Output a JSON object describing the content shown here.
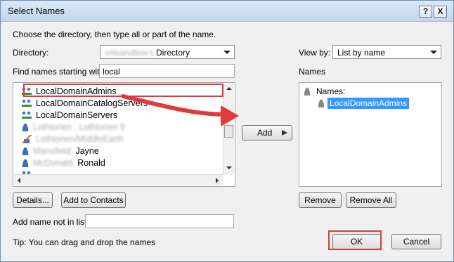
{
  "window": {
    "title": "Select Names",
    "help_label": "?",
    "close_label": "X"
  },
  "instructions": "Choose the directory, then type all or part of the name.",
  "directory": {
    "label": "Directory:",
    "value_blurred": "cntsandbox's",
    "value": "Directory"
  },
  "view_by": {
    "label": "View by:",
    "value": "List by name"
  },
  "find": {
    "label": "Find names starting with:",
    "value": "local"
  },
  "names_header": "Names",
  "names_tree": {
    "root_label": "Names:",
    "selected": "LocalDomainAdmins"
  },
  "list": {
    "items": [
      {
        "icon": "group-icon",
        "label": "LocalDomainAdmins",
        "blurred": ""
      },
      {
        "icon": "group-icon",
        "label": "LocalDomainCatalogServers",
        "blurred": ""
      },
      {
        "icon": "group-icon",
        "label": "LocalDomainServers",
        "blurred": ""
      },
      {
        "icon": "user-icon",
        "label": "",
        "blurred": "Lothlorien , Lothlorien 9"
      },
      {
        "icon": "house-icon",
        "label": "",
        "blurred": "Lothlorien/MiddleEarth"
      },
      {
        "icon": "user-icon",
        "label": "Jayne",
        "blurred": "Mansfield,"
      },
      {
        "icon": "user-icon",
        "label": "Ronald",
        "blurred": "McDonald,"
      }
    ]
  },
  "buttons": {
    "add": "Add",
    "details": "Details...",
    "add_to_contacts": "Add to Contacts",
    "remove": "Remove",
    "remove_all": "Remove All",
    "ok": "OK",
    "cancel": "Cancel"
  },
  "add_name": {
    "label": "Add name not in list:",
    "value": ""
  },
  "tip": "Tip: You can drag and drop the names",
  "colors": {
    "annotation_red": "#e03a3a",
    "selection_blue": "#3399ff"
  }
}
